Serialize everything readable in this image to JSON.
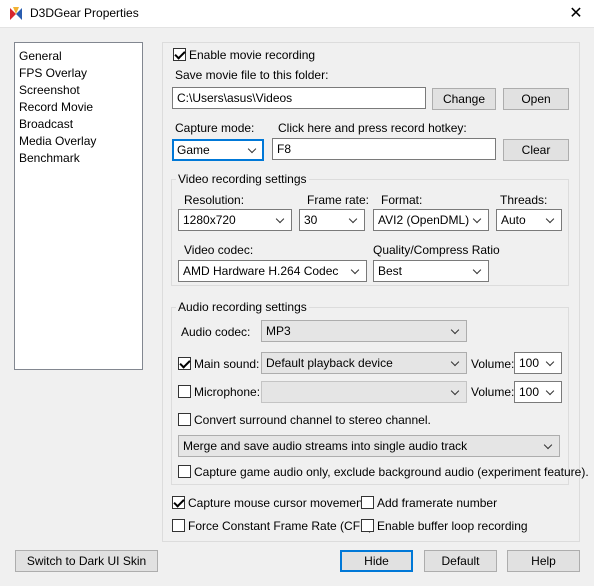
{
  "window": {
    "title": "D3DGear Properties"
  },
  "nav": {
    "items": [
      "General",
      "FPS Overlay",
      "Screenshot",
      "Record Movie",
      "Broadcast",
      "Media Overlay",
      "Benchmark"
    ]
  },
  "record": {
    "enable_label": "Enable movie recording",
    "save_folder_label": "Save movie file to this folder:",
    "save_folder_value": "C:\\Users\\asus\\Videos",
    "change_label": "Change",
    "open_label": "Open",
    "capture_mode_label": "Capture mode:",
    "capture_mode_value": "Game",
    "hotkey_label": "Click here and press record hotkey:",
    "hotkey_value": "F8",
    "clear_label": "Clear"
  },
  "video": {
    "group_label": "Video recording settings",
    "resolution_label": "Resolution:",
    "resolution_value": "1280x720",
    "framerate_label": "Frame rate:",
    "framerate_value": "30",
    "format_label": "Format:",
    "format_value": "AVI2 (OpenDML)",
    "threads_label": "Threads:",
    "threads_value": "Auto",
    "codec_label": "Video codec:",
    "codec_value": "AMD Hardware H.264 Codec",
    "quality_label": "Quality/Compress Ratio",
    "quality_value": "Best"
  },
  "audio": {
    "group_label": "Audio recording settings",
    "codec_label": "Audio codec:",
    "codec_value": "MP3",
    "main_sound_label": "Main sound:",
    "main_sound_value": "Default playback device",
    "volume_label": "Volume:",
    "main_volume_value": "100",
    "microphone_label": "Microphone:",
    "microphone_value": "",
    "mic_volume_value": "100",
    "convert_label": "Convert surround channel to stereo channel.",
    "merge_value": "Merge and save audio streams into single audio track",
    "capture_game_only_label": "Capture game audio only, exclude background audio (experiment feature)."
  },
  "options": {
    "cursor_label": "Capture mouse cursor movement",
    "framerate_number_label": "Add framerate number",
    "cfr_label": "Force Constant Frame Rate (CFR)",
    "buffer_loop_label": "Enable buffer loop recording"
  },
  "footer": {
    "dark_skin_label": "Switch to Dark UI Skin",
    "hide_label": "Hide",
    "default_label": "Default",
    "help_label": "Help"
  }
}
